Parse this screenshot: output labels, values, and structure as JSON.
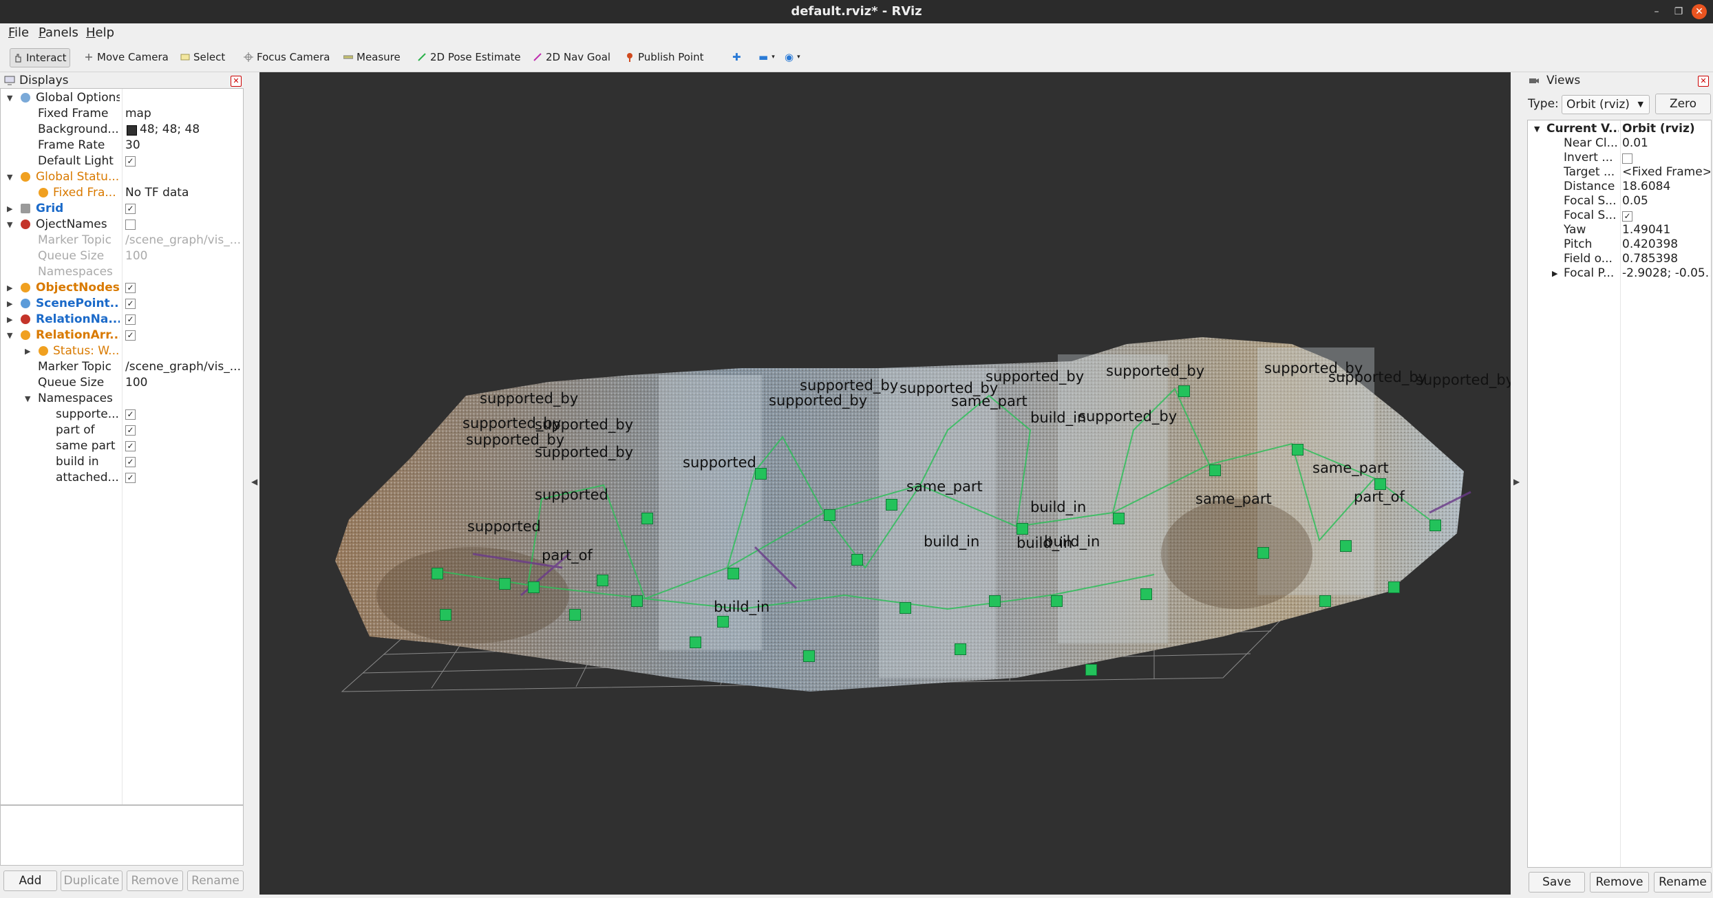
{
  "window": {
    "title": "default.rviz* - RViz"
  },
  "menu": [
    {
      "label": "File",
      "key": "F",
      "rest": "ile"
    },
    {
      "label": "Panels",
      "key": "P",
      "rest": "anels"
    },
    {
      "label": "Help",
      "key": "H",
      "rest": "elp"
    }
  ],
  "toolbar": {
    "interact": "Interact",
    "move_camera": "Move Camera",
    "select": "Select",
    "focus_camera": "Focus Camera",
    "measure": "Measure",
    "pose_estimate": "2D Pose Estimate",
    "nav_goal": "2D Nav Goal",
    "publish_point": "Publish Point"
  },
  "displays": {
    "title": "Displays",
    "rows": [
      {
        "label": "Global Options",
        "value": ""
      },
      {
        "label": "Fixed Frame",
        "value": "map"
      },
      {
        "label": "Background...",
        "value": "48; 48; 48"
      },
      {
        "label": "Frame Rate",
        "value": "30"
      },
      {
        "label": "Default Light",
        "value": "✓"
      },
      {
        "label": "Global Statu...",
        "value": ""
      },
      {
        "label": "Fixed Fra...",
        "value": "No TF data"
      },
      {
        "label": "Grid",
        "value": "✓"
      },
      {
        "label": "OjectNames",
        "value": ""
      },
      {
        "label": "Marker Topic",
        "value": "/scene_graph/vis_..."
      },
      {
        "label": "Queue Size",
        "value": "100"
      },
      {
        "label": "Namespaces",
        "value": ""
      },
      {
        "label": "ObjectNodes",
        "value": "✓"
      },
      {
        "label": "ScenePoint...",
        "value": "✓"
      },
      {
        "label": "RelationNa...",
        "value": "✓"
      },
      {
        "label": "RelationArr...",
        "value": "✓"
      },
      {
        "label": "Status: W...",
        "value": ""
      },
      {
        "label": "Marker Topic",
        "value": "/scene_graph/vis_..."
      },
      {
        "label": "Queue Size",
        "value": "100"
      },
      {
        "label": "Namespaces",
        "value": ""
      },
      {
        "label": "supporte...",
        "value": "✓"
      },
      {
        "label": "part of",
        "value": "✓"
      },
      {
        "label": "same part",
        "value": "✓"
      },
      {
        "label": "build in",
        "value": "✓"
      },
      {
        "label": "attached...",
        "value": "✓"
      }
    ],
    "buttons": {
      "add": "Add",
      "duplicate": "Duplicate",
      "remove": "Remove",
      "rename": "Rename"
    }
  },
  "views": {
    "title": "Views",
    "type_label": "Type:",
    "type_value": "Orbit (rviz)",
    "zero": "Zero",
    "rows": [
      {
        "label": "Current V...",
        "value": "Orbit (rviz)"
      },
      {
        "label": "Near Cl...",
        "value": "0.01"
      },
      {
        "label": "Invert ...",
        "value": ""
      },
      {
        "label": "Target ...",
        "value": "<Fixed Frame>"
      },
      {
        "label": "Distance",
        "value": "18.6084"
      },
      {
        "label": "Focal S...",
        "value": "0.05"
      },
      {
        "label": "Focal S...",
        "value": "✓"
      },
      {
        "label": "Yaw",
        "value": "1.49041"
      },
      {
        "label": "Pitch",
        "value": "0.420398"
      },
      {
        "label": "Field o...",
        "value": "0.785398"
      },
      {
        "label": "Focal P...",
        "value": "-2.9028; -0.05..."
      }
    ],
    "buttons": {
      "save": "Save",
      "remove": "Remove",
      "rename": "Rename"
    }
  },
  "viewport_labels": [
    "supported_by",
    "supported_by",
    "supported_by",
    "supported_by",
    "supported_by",
    "supported_by",
    "supported_by",
    "supported_by",
    "supported_by",
    "supported_by",
    "supported_by",
    "supported_by",
    "supported_by",
    "supported_by",
    "same_part",
    "same_part",
    "same_part",
    "same_part",
    "build_in",
    "build_in",
    "build_in",
    "build_in",
    "build_in",
    "build_in",
    "supported",
    "supported",
    "supported",
    "part_of",
    "part_of"
  ],
  "colors": {
    "background": "#303030",
    "node": "#23c25b",
    "edge": "#2fbf5a",
    "accent_orange": "#e95420"
  }
}
